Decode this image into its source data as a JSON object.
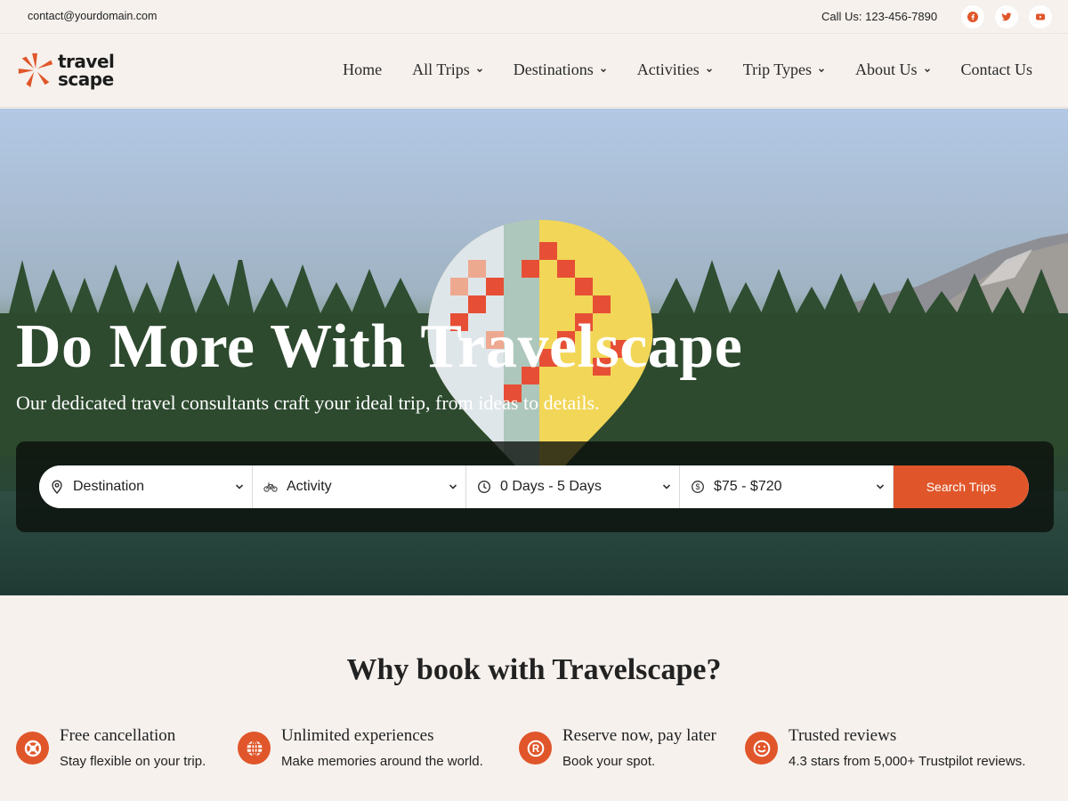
{
  "topbar": {
    "email": "contact@yourdomain.com",
    "phone": "Call Us: 123-456-7890",
    "social": [
      {
        "name": "facebook",
        "icon": "facebook-icon"
      },
      {
        "name": "twitter",
        "icon": "twitter-icon"
      },
      {
        "name": "youtube",
        "icon": "youtube-icon"
      }
    ]
  },
  "header": {
    "logo_line1": "travel",
    "logo_line2": "scape",
    "nav": [
      {
        "label": "Home",
        "dropdown": false
      },
      {
        "label": "All Trips",
        "dropdown": true
      },
      {
        "label": "Destinations",
        "dropdown": true
      },
      {
        "label": "Activities",
        "dropdown": true
      },
      {
        "label": "Trip Types",
        "dropdown": true
      },
      {
        "label": "About Us",
        "dropdown": true
      },
      {
        "label": "Contact Us",
        "dropdown": false
      }
    ]
  },
  "hero": {
    "title": "Do More With Travelscape",
    "subtitle": "Our dedicated travel consultants craft your ideal trip, from ideas to details.",
    "search": {
      "fields": [
        {
          "label": "Destination",
          "icon": "map-pin-icon"
        },
        {
          "label": "Activity",
          "icon": "bicycle-icon"
        },
        {
          "label": "0 Days - 5 Days",
          "icon": "clock-icon"
        },
        {
          "label": "$75 - $720",
          "icon": "dollar-icon"
        }
      ],
      "button_label": "Search Trips"
    }
  },
  "why": {
    "title": "Why book with Travelscape?",
    "features": [
      {
        "title": "Free cancellation",
        "desc": "Stay flexible on your trip.",
        "icon": "lifebuoy-icon"
      },
      {
        "title": "Unlimited experiences",
        "desc": "Make memories around the world.",
        "icon": "globe-icon"
      },
      {
        "title": "Reserve now, pay later",
        "desc": "Book your spot.",
        "icon": "registered-icon"
      },
      {
        "title": "Trusted reviews",
        "desc": "4.3 stars from 5,000+ Trustpilot reviews.",
        "icon": "smile-icon"
      }
    ]
  },
  "colors": {
    "accent": "#e0562a",
    "background": "#f6f1ed",
    "text": "#222222"
  }
}
